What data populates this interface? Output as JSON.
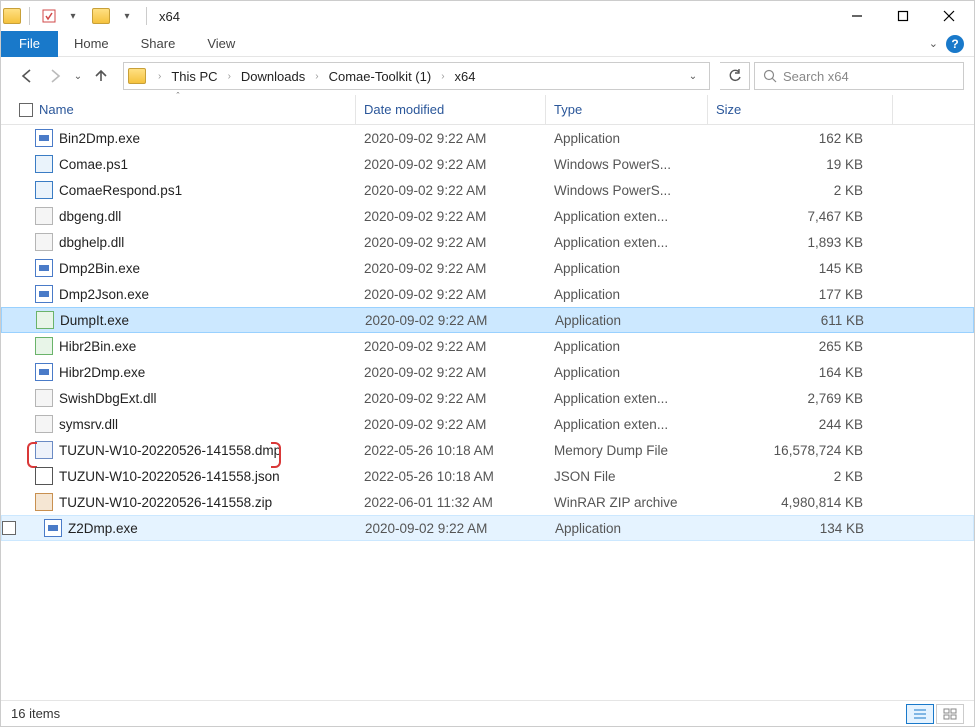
{
  "window": {
    "title": "x64"
  },
  "ribbon": {
    "file": "File",
    "tabs": [
      "Home",
      "Share",
      "View"
    ]
  },
  "breadcrumb": [
    "This PC",
    "Downloads",
    "Comae-Toolkit (1)",
    "x64"
  ],
  "search": {
    "placeholder": "Search x64"
  },
  "columns": {
    "name": "Name",
    "date": "Date modified",
    "type": "Type",
    "size": "Size"
  },
  "files": [
    {
      "name": "Bin2Dmp.exe",
      "date": "2020-09-02 9:22 AM",
      "type": "Application",
      "size": "162 KB",
      "icon": "exe"
    },
    {
      "name": "Comae.ps1",
      "date": "2020-09-02 9:22 AM",
      "type": "Windows PowerS...",
      "size": "19 KB",
      "icon": "ps1"
    },
    {
      "name": "ComaeRespond.ps1",
      "date": "2020-09-02 9:22 AM",
      "type": "Windows PowerS...",
      "size": "2 KB",
      "icon": "ps1"
    },
    {
      "name": "dbgeng.dll",
      "date": "2020-09-02 9:22 AM",
      "type": "Application exten...",
      "size": "7,467 KB",
      "icon": "dll"
    },
    {
      "name": "dbghelp.dll",
      "date": "2020-09-02 9:22 AM",
      "type": "Application exten...",
      "size": "1,893 KB",
      "icon": "dll"
    },
    {
      "name": "Dmp2Bin.exe",
      "date": "2020-09-02 9:22 AM",
      "type": "Application",
      "size": "145 KB",
      "icon": "exe"
    },
    {
      "name": "Dmp2Json.exe",
      "date": "2020-09-02 9:22 AM",
      "type": "Application",
      "size": "177 KB",
      "icon": "exe"
    },
    {
      "name": "DumpIt.exe",
      "date": "2020-09-02 9:22 AM",
      "type": "Application",
      "size": "611 KB",
      "icon": "special",
      "selected": true
    },
    {
      "name": "Hibr2Bin.exe",
      "date": "2020-09-02 9:22 AM",
      "type": "Application",
      "size": "265 KB",
      "icon": "special"
    },
    {
      "name": "Hibr2Dmp.exe",
      "date": "2020-09-02 9:22 AM",
      "type": "Application",
      "size": "164 KB",
      "icon": "exe"
    },
    {
      "name": "SwishDbgExt.dll",
      "date": "2020-09-02 9:22 AM",
      "type": "Application exten...",
      "size": "2,769 KB",
      "icon": "dll"
    },
    {
      "name": "symsrv.dll",
      "date": "2020-09-02 9:22 AM",
      "type": "Application exten...",
      "size": "244 KB",
      "icon": "dll"
    },
    {
      "name": "TUZUN-W10-20220526-141558.dmp",
      "date": "2022-05-26 10:18 AM",
      "type": "Memory Dump File",
      "size": "16,578,724 KB",
      "icon": "dmp",
      "annotated": true
    },
    {
      "name": "TUZUN-W10-20220526-141558.json",
      "date": "2022-05-26 10:18 AM",
      "type": "JSON File",
      "size": "2 KB",
      "icon": "json"
    },
    {
      "name": "TUZUN-W10-20220526-141558.zip",
      "date": "2022-06-01 11:32 AM",
      "type": "WinRAR ZIP archive",
      "size": "4,980,814 KB",
      "icon": "zip"
    },
    {
      "name": "Z2Dmp.exe",
      "date": "2020-09-02 9:22 AM",
      "type": "Application",
      "size": "134 KB",
      "icon": "exe",
      "highlight": true,
      "checkbox": true
    }
  ],
  "status": {
    "count": "16 items"
  }
}
